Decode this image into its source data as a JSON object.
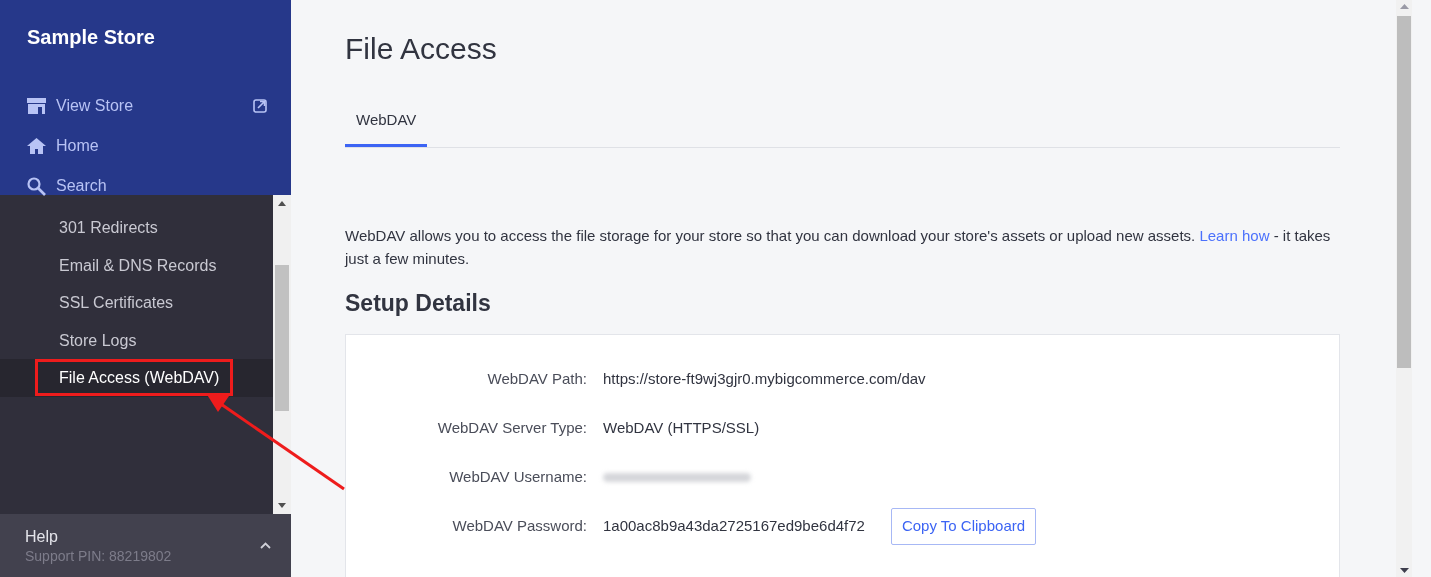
{
  "store_name": "Sample Store",
  "top_nav": [
    {
      "label": "View Store",
      "external": true
    },
    {
      "label": "Home",
      "external": false
    },
    {
      "label": "Search",
      "external": false
    }
  ],
  "nav_items": [
    {
      "label": "301 Redirects",
      "selected": false
    },
    {
      "label": "Email & DNS Records",
      "selected": false
    },
    {
      "label": "SSL Certificates",
      "selected": false
    },
    {
      "label": "Store Logs",
      "selected": false
    },
    {
      "label": "File Access (WebDAV)",
      "selected": true
    }
  ],
  "help": {
    "title": "Help",
    "support_pin": "Support PIN: 88219802"
  },
  "page_title": "File Access",
  "tabs": [
    {
      "label": "WebDAV",
      "selected": true
    }
  ],
  "intro": {
    "text": "WebDAV allows you to access the file storage for your store so that you can download your store's assets or upload new assets.",
    "link": "Learn how",
    "after": "- it takes just a few minutes."
  },
  "section_title": "Setup Details",
  "details": [
    {
      "label": "WebDAV Path:",
      "kind": "text",
      "value": "https://store-ft9wj3gjr0.mybigcommerce.com/dav"
    },
    {
      "label": "WebDAV Server Type:",
      "kind": "text",
      "value": "WebDAV (HTTPS/SSL)"
    },
    {
      "label": "WebDAV Username:",
      "kind": "redacted"
    },
    {
      "label": "WebDAV Password:",
      "kind": "text",
      "value": "1a00ac8b9a43da2725167ed9be6d4f72",
      "button": "Copy To Clipboard"
    }
  ]
}
